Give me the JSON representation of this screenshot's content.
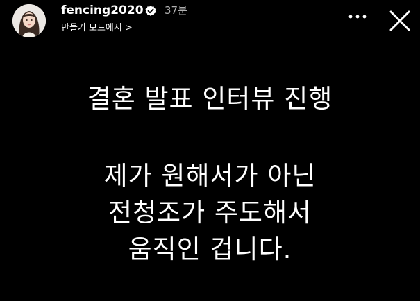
{
  "header": {
    "username": "fencing2020",
    "time": "37분",
    "subtitle": "만들기 모드에서 >",
    "avatar_icon": "profile-avatar",
    "verified_icon": "verified-badge-icon",
    "more_icon": "more-icon",
    "close_icon": "close-icon"
  },
  "story": {
    "headline": "결혼 발표 인터뷰 진행",
    "lines": [
      "제가 원해서가 아닌",
      "전청조가 주도해서",
      "움직인 겁니다."
    ]
  },
  "colors": {
    "background": "#000000",
    "text": "#ffffff",
    "muted": "#b0b0b0"
  }
}
